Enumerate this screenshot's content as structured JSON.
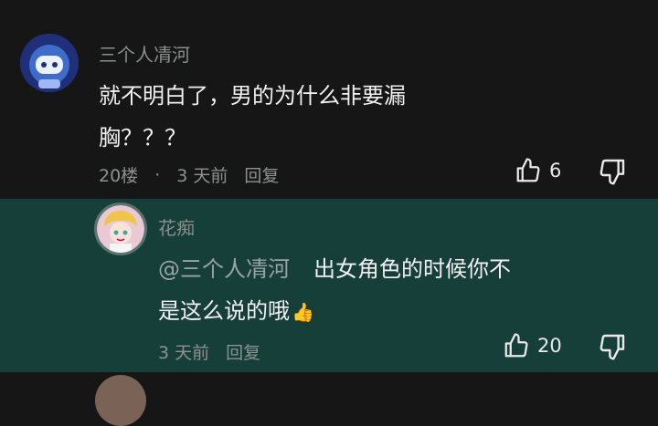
{
  "comments": [
    {
      "username": "三个人凊河",
      "text_line1": "就不明白了，男的为什么非要漏",
      "text_line2": "胸？？？",
      "floor": "20楼",
      "separator": "·",
      "time": "3 天前",
      "reply_label": "回复",
      "likes": "6",
      "avatar_icon": "robot-avatar-icon"
    },
    {
      "username": "花痴",
      "mention": "@三个人凊河",
      "text_line1": "出女角色的时候你不",
      "text_line2": "是这么说的哦",
      "emoji": "👍",
      "time": "3 天前",
      "reply_label": "回复",
      "likes": "20",
      "avatar_icon": "anime-girl-avatar-icon"
    }
  ],
  "colors": {
    "background": "#161616",
    "reply_background": "#173f3a",
    "username": "#8a8f8c",
    "text": "#f1f1f1",
    "meta": "#8d918f"
  }
}
